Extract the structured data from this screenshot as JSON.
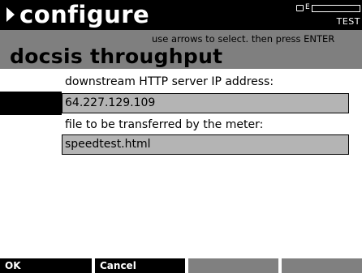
{
  "topbar": {
    "title": "configure",
    "battery_label": "E",
    "mode": "TEST"
  },
  "header": {
    "hint": "use arrows to select. then press ENTER",
    "screen_title": "docsis throughput"
  },
  "fields": [
    {
      "label": "downstream HTTP server IP address:",
      "value": "64.227.129.109",
      "selected": true
    },
    {
      "label": "file to be transferred by the meter:",
      "value": "speedtest.html",
      "selected": false
    }
  ],
  "softkeys": [
    "OK",
    "Cancel",
    "",
    ""
  ],
  "colors": {
    "bar": "#000000",
    "header_band": "#7f7f7f",
    "field_bg": "#b4b4b4",
    "disabled_softkey": "#808080"
  }
}
